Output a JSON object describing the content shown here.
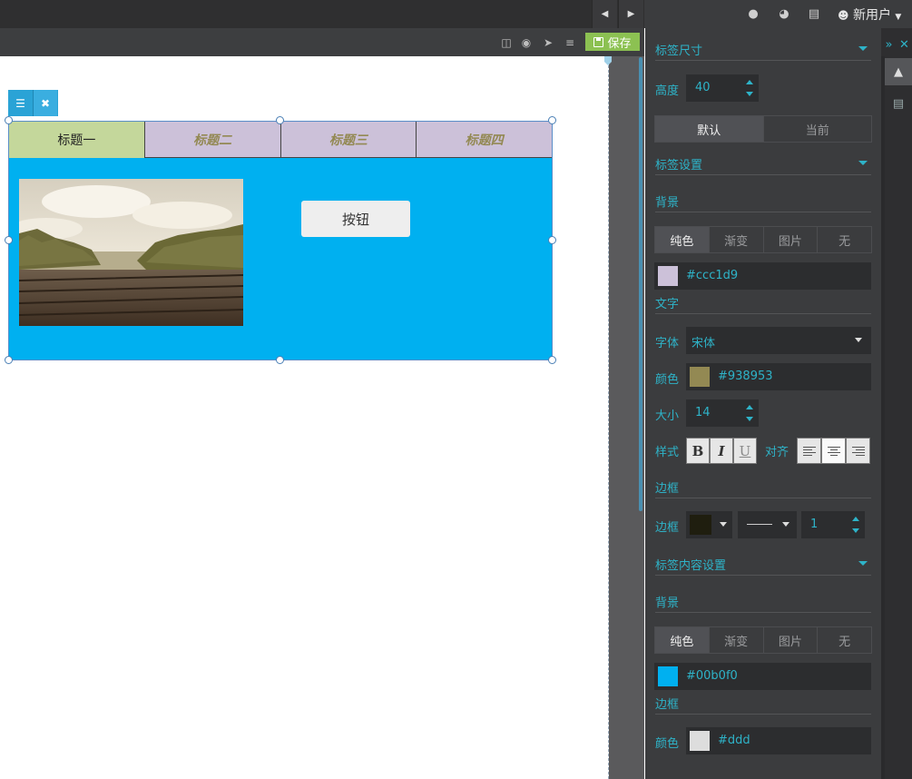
{
  "topbar": {
    "prev_icon": "chevron-left-icon",
    "next_icon": "chevron-right-icon",
    "icons": [
      "globe-icon",
      "dashboard-icon",
      "list-icon"
    ],
    "user_name": "新用户"
  },
  "toolbar": {
    "icons": [
      "export-icon",
      "preview-icon",
      "publish-icon",
      "settings-icon"
    ],
    "save_label": "保存"
  },
  "canvas": {
    "tabs": [
      {
        "label": "标题一",
        "active": true
      },
      {
        "label": "标题二",
        "active": false
      },
      {
        "label": "标题三",
        "active": false
      },
      {
        "label": "标题四",
        "active": false
      }
    ],
    "button_label": "按钮",
    "colors": {
      "active_tab_bg": "#c4d79b",
      "tab_bg": "#ccc1d9",
      "tab_text": "#938953",
      "content_bg": "#00b0f0",
      "button_bg": "#eeeeee"
    }
  },
  "panel": {
    "tab_size": {
      "title": "标签尺寸",
      "height_label": "高度",
      "height_value": "40",
      "modes": [
        "默认",
        "当前"
      ]
    },
    "tab_settings": {
      "title": "标签设置",
      "bg_label": "背景",
      "fill_types": [
        "纯色",
        "渐变",
        "图片",
        "无"
      ],
      "bg_color": "#ccc1d9",
      "text_label": "文字",
      "font_label": "字体",
      "font_value": "宋体",
      "color_label": "颜色",
      "color_value": "#938953",
      "size_label": "大小",
      "size_value": "14",
      "style_label": "样式",
      "bold": "B",
      "italic": "I",
      "underline": "U",
      "align_label": "对齐",
      "border_label": "边框",
      "border_row_label": "边框",
      "border_color": "#1f1e0f",
      "border_width": "1"
    },
    "content_settings": {
      "title": "标签内容设置",
      "bg_label": "背景",
      "fill_types": [
        "纯色",
        "渐变",
        "图片",
        "无"
      ],
      "bg_color": "#00b0f0",
      "border_label": "边框",
      "color_label": "颜色",
      "border_color": "#ddd"
    }
  }
}
